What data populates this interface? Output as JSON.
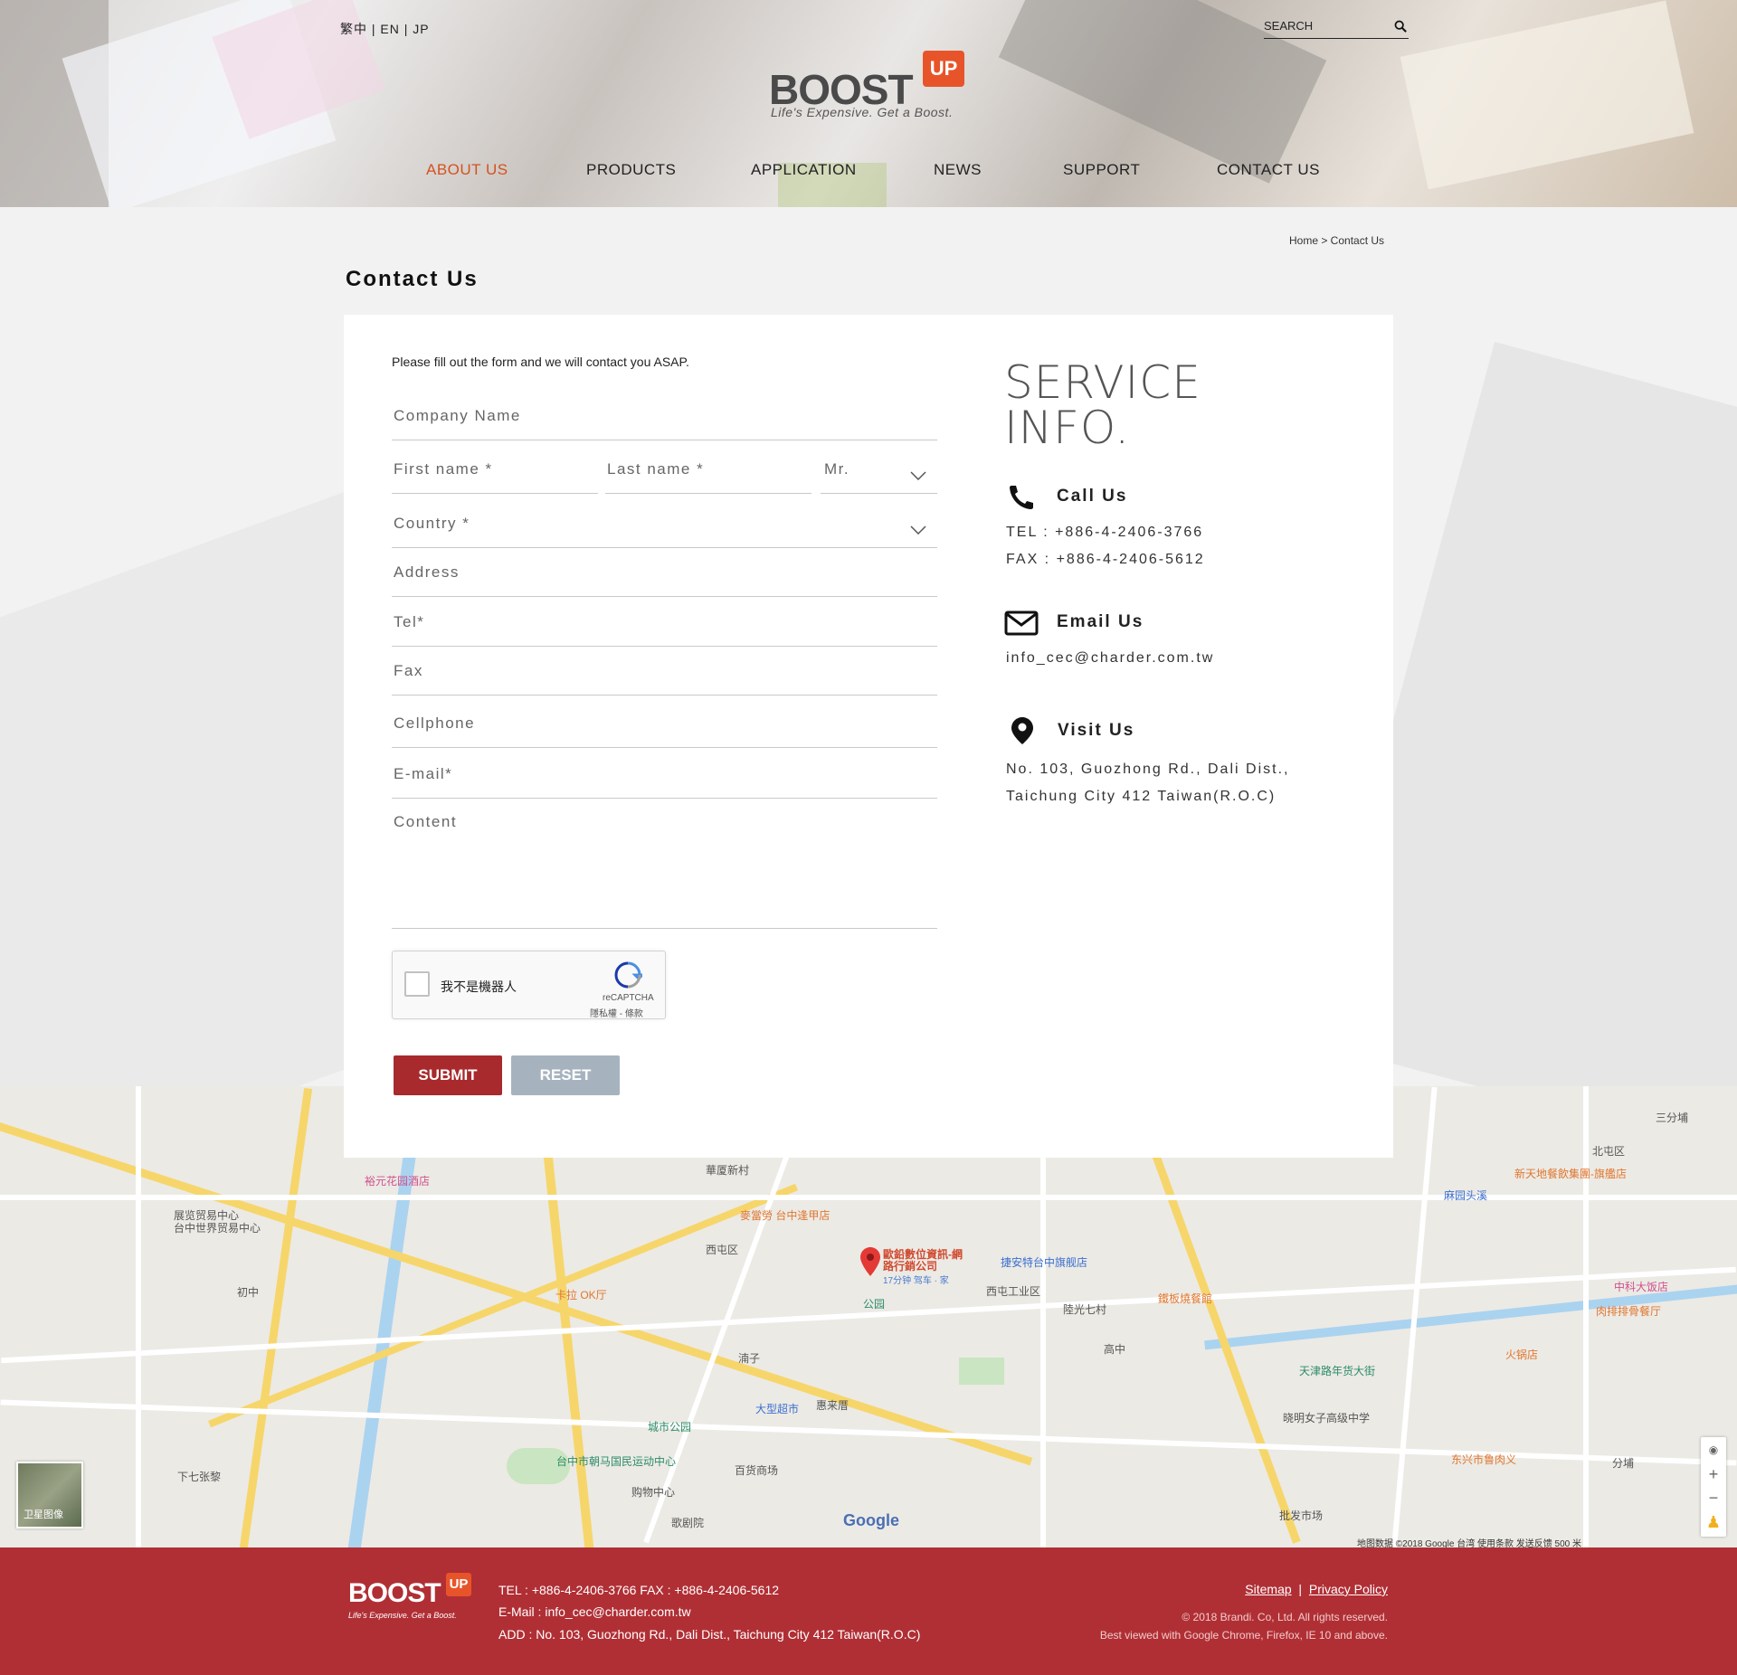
{
  "header": {
    "languages": "繁中 | EN | JP",
    "search_label": "SEARCH",
    "logo_word": "BOOST",
    "logo_badge": "UP",
    "logo_tagline": "Life's Expensive. Get a Boost.",
    "nav": [
      {
        "label": "ABOUT US",
        "active": true
      },
      {
        "label": "PRODUCTS",
        "active": false
      },
      {
        "label": "APPLICATION",
        "active": false
      },
      {
        "label": "NEWS",
        "active": false
      },
      {
        "label": "SUPPORT",
        "active": false
      },
      {
        "label": "CONTACT US",
        "active": false
      }
    ],
    "accent_color": "#d4521f"
  },
  "breadcrumb": "Home > Contact Us",
  "page_title": "Contact Us",
  "form": {
    "intro": "Please fill out the form and we will contact you ASAP.",
    "company_placeholder": "Company Name",
    "first_name_placeholder": "First name *",
    "last_name_placeholder": "Last name *",
    "title_select": "Mr.",
    "country_placeholder": "Country *",
    "address_placeholder": "Address",
    "tel_placeholder": "Tel*",
    "fax_placeholder": "Fax",
    "cellphone_placeholder": "Cellphone",
    "email_placeholder": "E-mail*",
    "content_placeholder": "Content",
    "captcha_label": "我不是機器人",
    "captcha_brand": "reCAPTCHA",
    "captcha_terms": "隱私權 - 條款",
    "submit_label": "SUBMIT",
    "reset_label": "RESET",
    "submit_color": "#a82a2d",
    "reset_color": "#a6b3bf"
  },
  "service": {
    "title_line1": "SERVICE",
    "title_line2": "INFO.",
    "call_heading": "Call Us",
    "tel": "TEL : +886-4-2406-3766",
    "fax": "FAX : +886-4-2406-5612",
    "email_heading": "Email Us",
    "email": "info_cec@charder.com.tw",
    "visit_heading": "Visit Us",
    "address_line1": "No. 103, Guozhong Rd., Dali Dist.,",
    "address_line2": "Taichung City 412 Taiwan(R.O.C)"
  },
  "map": {
    "pin_label_line1": "歐鉛數位資訊-網",
    "pin_label_line2": "路行銷公司",
    "pin_sub": "17分钟 驾车 · 家",
    "satellite_label": "卫星图像",
    "google_label": "Google",
    "attribution": "地图数据 ©2018 Google   台湾   使用条款   发送反馈   500 米",
    "labels": [
      "華厦新村",
      "西屯区",
      "西屯工业区",
      "陸光七村",
      "惠来厝",
      "湳子",
      "北屯区",
      "三分埔",
      "下七张黎",
      "初中",
      "展览贸易中心",
      "台中世界贸易中心",
      "裕元花园酒店",
      "捷安特台中旗舰店",
      "天津路年货大街",
      "晓明女子高级中学",
      "大型超市",
      "百货商场",
      "城市公园",
      "台中市朝马国民运动中心",
      "中科大饭店",
      "肉排排骨餐厅",
      "火锅店",
      "东兴市鲁肉义",
      "批发市场",
      "歌剧院",
      "购物中心",
      "高中",
      "公园",
      "麻园头溪",
      "新天地餐飲集團-旗艦店",
      "麥當勞 台中逢甲店",
      "卡拉 OK厅",
      "鐵板燒餐館",
      "分埔"
    ]
  },
  "footer": {
    "logo_word": "BOOST",
    "logo_badge": "UP",
    "logo_tagline": "Life's Expensive. Get a Boost.",
    "line1": "TEL : +886-4-2406-3766   FAX : +886-4-2406-5612",
    "line2": "E-Mail : info_cec@charder.com.tw",
    "line3": "ADD : No. 103, Guozhong Rd., Dali Dist., Taichung City 412 Taiwan(R.O.C)",
    "sitemap": "Sitemap",
    "privacy": "Privacy Policy",
    "copyright": "© 2018 Brandi. Co, Ltd. All rights reserved.",
    "browsers": "Best viewed with Google Chrome, Firefox, IE 10 and above.",
    "bg_color": "#b02f35"
  }
}
